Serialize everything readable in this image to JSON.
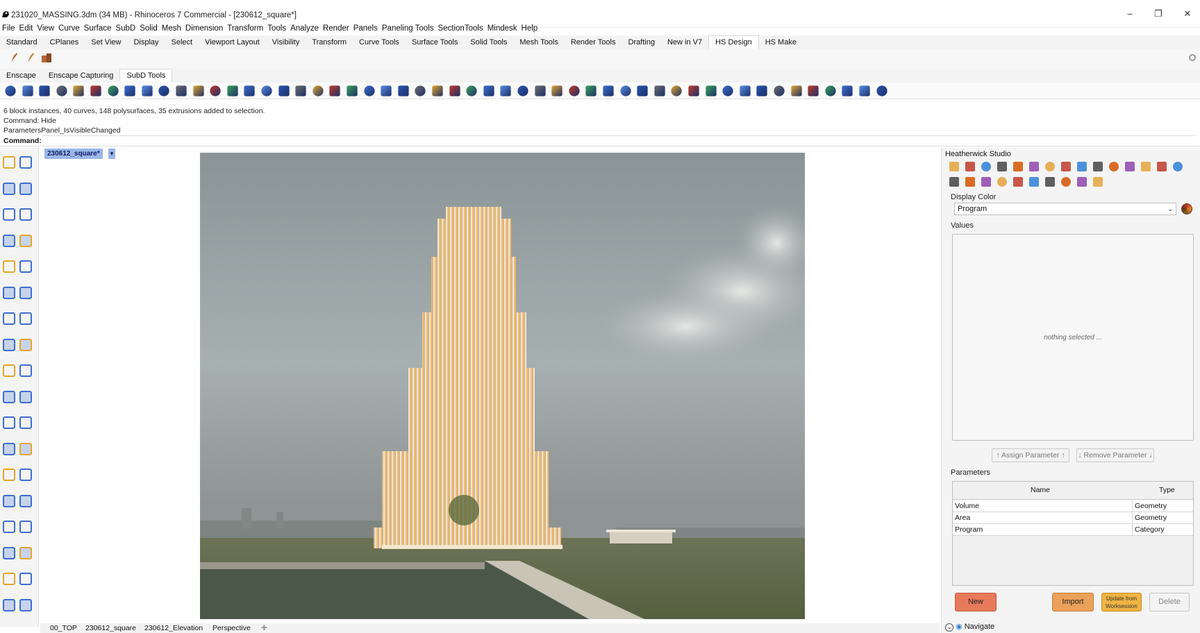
{
  "window": {
    "title": "231020_MASSING.3dm (34 MB) - Rhinoceros 7 Commercial - [230612_square*]"
  },
  "menu": [
    "File",
    "Edit",
    "View",
    "Curve",
    "Surface",
    "SubD",
    "Solid",
    "Mesh",
    "Dimension",
    "Transform",
    "Tools",
    "Analyze",
    "Render",
    "Panels",
    "Paneling Tools",
    "SectionTools",
    "Mindesk",
    "Help"
  ],
  "toolbar_tabs_1": [
    "Standard",
    "CPlanes",
    "Set View",
    "Display",
    "Select",
    "Viewport Layout",
    "Visibility",
    "Transform",
    "Curve Tools",
    "Surface Tools",
    "Solid Tools",
    "Mesh Tools",
    "Render Tools",
    "Drafting",
    "New in V7",
    "HS Design",
    "HS Make"
  ],
  "toolbar_tabs_1_active": "HS Design",
  "toolbar_tabs_2": [
    "Enscape",
    "Enscape Capturing",
    "SubD Tools"
  ],
  "command_history": [
    "6 block instances, 40 curves, 148 polysurfaces, 35 extrusions added to selection.",
    "Command: Hide",
    "ParametersPanel_IsVisibleChanged"
  ],
  "command_label": "Command:",
  "viewport": {
    "tab": "230612_square*",
    "status": [
      "00_TOP",
      "230612_square",
      "230612_Elevation",
      "Perspective"
    ]
  },
  "panel": {
    "title": "Heatherwick Studio",
    "display_color_label": "Display Color",
    "display_color_value": "Program",
    "values_label": "Values",
    "nothing_selected": "nothing selected ...",
    "assign_param": "↑ Assign Parameter ↑",
    "remove_param": "↓ Remove Parameter ↓",
    "parameters_label": "Parameters",
    "table_headers": [
      "Name",
      "Type"
    ],
    "rows": [
      {
        "name": "Volume",
        "type": "Geometry"
      },
      {
        "name": "Area",
        "type": "Geometry"
      },
      {
        "name": "Program",
        "type": "Category"
      }
    ],
    "btn_new": "New",
    "btn_import": "Import",
    "btn_update": "Update from Worksession",
    "btn_delete": "Delete",
    "navigate": "Navigate"
  },
  "colors": {
    "viewport_tab": "#9bb7e8",
    "new_button": "#e87a5c",
    "import_button": "#eba15a",
    "update_button": "#efb443"
  }
}
